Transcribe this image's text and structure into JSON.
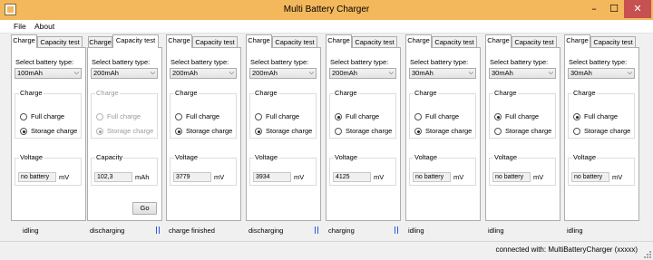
{
  "window": {
    "title": "Multi Battery Charger",
    "buttons": {
      "minimize": "–",
      "maximize": "☐",
      "close": "✕"
    }
  },
  "menu": [
    "File",
    "About"
  ],
  "common": {
    "tabs": [
      "Charge",
      "Capacity test"
    ],
    "select_label": "Select battery type:",
    "charge_group": "Charge",
    "full_charge": "Full charge",
    "storage_charge": "Storage charge",
    "voltage_group": "Voltage",
    "capacity_group": "Capacity",
    "unit_mv": "mV",
    "unit_mah": "mAh",
    "go": "Go"
  },
  "chargers": [
    {
      "active_tab": 0,
      "battery_type": "100mAh",
      "mode": "storage",
      "voltage": "no battery",
      "status": "idling",
      "indicator": false
    },
    {
      "active_tab": 1,
      "battery_type": "200mAh",
      "mode": "storage",
      "capacity": "102,3",
      "status": "discharging",
      "indicator": true
    },
    {
      "active_tab": 0,
      "battery_type": "200mAh",
      "mode": "storage",
      "voltage": "3779",
      "status": "charge finished",
      "indicator": false
    },
    {
      "active_tab": 0,
      "battery_type": "200mAh",
      "mode": "storage",
      "voltage": "3934",
      "status": "discharging",
      "indicator": true
    },
    {
      "active_tab": 0,
      "battery_type": "200mAh",
      "mode": "full",
      "voltage": "4125",
      "status": "charging",
      "indicator": true
    },
    {
      "active_tab": 0,
      "battery_type": "30mAh",
      "mode": "storage",
      "voltage": "no battery",
      "status": "idling",
      "indicator": false
    },
    {
      "active_tab": 0,
      "battery_type": "30mAh",
      "mode": "full",
      "voltage": "no battery",
      "status": "idling",
      "indicator": false
    },
    {
      "active_tab": 0,
      "battery_type": "30mAh",
      "mode": "full",
      "voltage": "no battery",
      "status": "idling",
      "indicator": false
    }
  ],
  "statusbar": {
    "connection": "connected with: MultiBatteryCharger (xxxxx)"
  },
  "colors": {
    "titlebar": "#f3b85c",
    "close_button": "#c75050",
    "activity_indicator": "#2b5bd6"
  }
}
